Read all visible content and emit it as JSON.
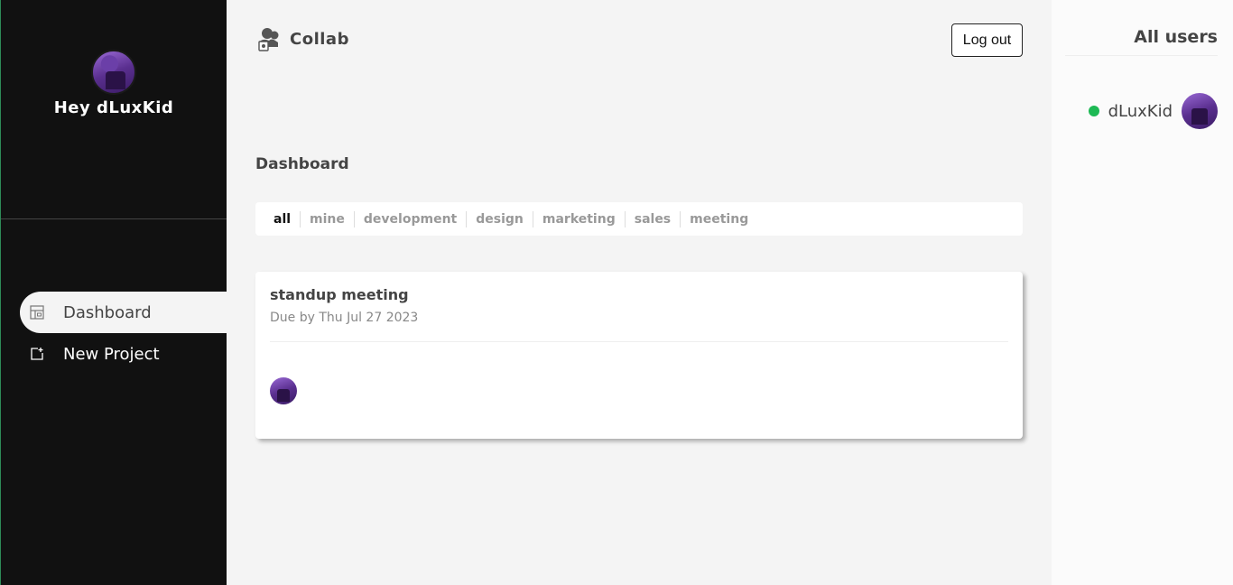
{
  "sidebar": {
    "greeting": "Hey dLuxKid",
    "avatar_icon": "user-avatar",
    "items": [
      {
        "label": "Dashboard",
        "icon": "dashboard-icon",
        "active": true
      },
      {
        "label": "New Project",
        "icon": "add-project-icon",
        "active": false
      }
    ]
  },
  "header": {
    "brand": "Collab",
    "logout_label": "Log out"
  },
  "main": {
    "page_title": "Dashboard",
    "filters": [
      "all",
      "mine",
      "development",
      "design",
      "marketing",
      "sales",
      "meeting"
    ],
    "active_filter": "all",
    "projects": [
      {
        "title": "standup meeting",
        "due": "Due by Thu Jul 27 2023"
      }
    ]
  },
  "users_panel": {
    "title": "All users",
    "users": [
      {
        "name": "dLuxKid",
        "online": true
      }
    ]
  },
  "colors": {
    "sidebar_bg": "#111111",
    "main_bg": "#f4f4f4",
    "online": "#1db954"
  }
}
